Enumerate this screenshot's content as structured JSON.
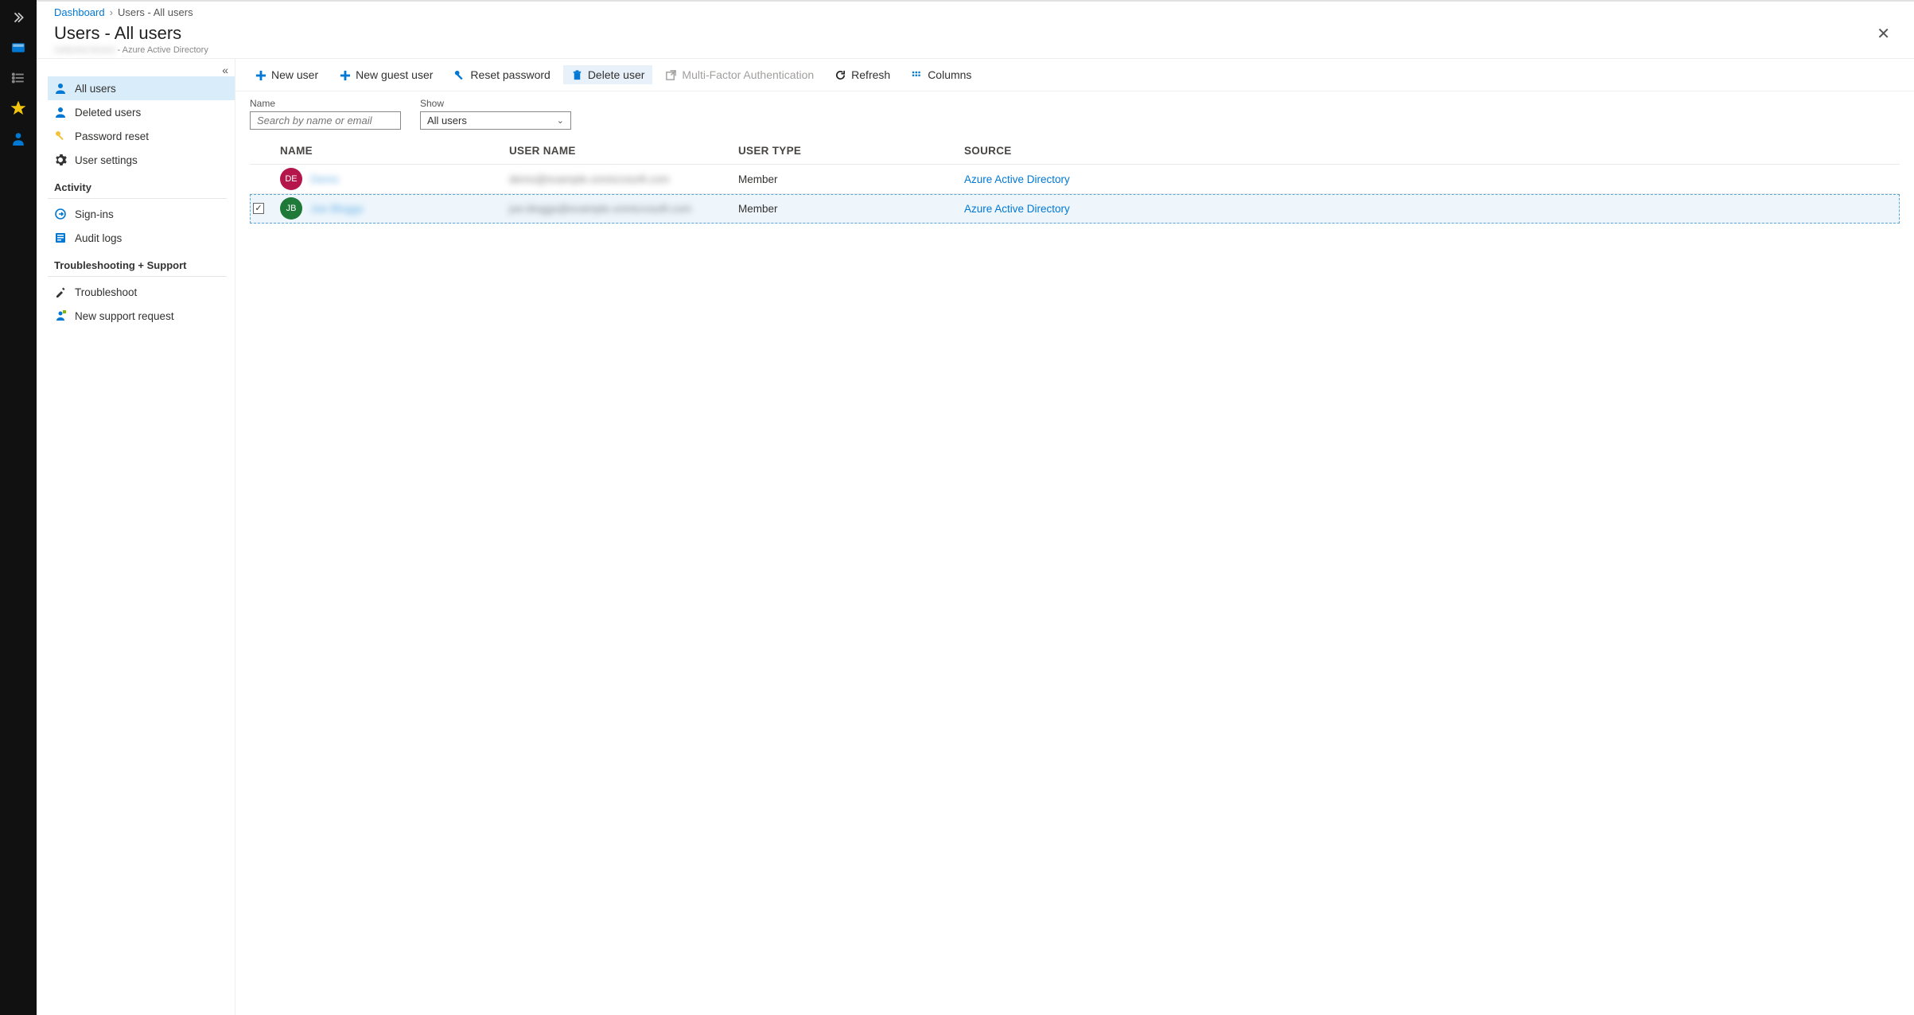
{
  "breadcrumb": {
    "root": "Dashboard",
    "current": "Users - All users"
  },
  "header": {
    "title": "Users - All users",
    "subtitle_suffix": "- Azure Active Directory"
  },
  "subnav": {
    "items": [
      {
        "label": "All users"
      },
      {
        "label": "Deleted users"
      },
      {
        "label": "Password reset"
      },
      {
        "label": "User settings"
      }
    ],
    "groups": [
      {
        "label": "Activity",
        "items": [
          {
            "label": "Sign-ins"
          },
          {
            "label": "Audit logs"
          }
        ]
      },
      {
        "label": "Troubleshooting + Support",
        "items": [
          {
            "label": "Troubleshoot"
          },
          {
            "label": "New support request"
          }
        ]
      }
    ]
  },
  "toolbar": {
    "new_user": "New user",
    "new_guest": "New guest user",
    "reset_pw": "Reset password",
    "delete_user": "Delete user",
    "mfa": "Multi-Factor Authentication",
    "refresh": "Refresh",
    "columns": "Columns"
  },
  "filters": {
    "name_label": "Name",
    "name_placeholder": "Search by name or email",
    "show_label": "Show",
    "show_value": "All users"
  },
  "table": {
    "headers": {
      "name": "Name",
      "user_name": "User name",
      "user_type": "User type",
      "source": "Source"
    },
    "rows": [
      {
        "selected": false,
        "avatar_text": "DE",
        "avatar_color": "#b4154b",
        "name": "Demo",
        "user_name": "demo@example.onmicrosoft.com",
        "user_type": "Member",
        "source": "Azure Active Directory"
      },
      {
        "selected": true,
        "avatar_text": "JB",
        "avatar_color": "#1f7a3a",
        "name": "Joe Bloggs",
        "user_name": "joe.bloggs@example.onmicrosoft.com",
        "user_type": "Member",
        "source": "Azure Active Directory"
      }
    ]
  }
}
